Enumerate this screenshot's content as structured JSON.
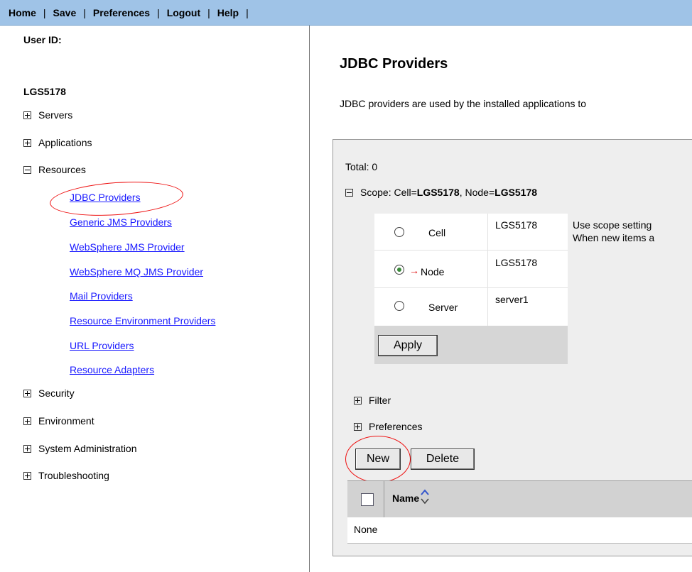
{
  "topnav": {
    "items": [
      "Home",
      "Save",
      "Preferences",
      "Logout",
      "Help"
    ],
    "separator": "|"
  },
  "leftnav": {
    "userid_label": "User ID:",
    "userid_value": "LGS5178",
    "tree": [
      {
        "label": "Servers",
        "state": "collapsed"
      },
      {
        "label": "Applications",
        "state": "collapsed"
      },
      {
        "label": "Resources",
        "state": "expanded"
      },
      {
        "label": "Security",
        "state": "collapsed"
      },
      {
        "label": "Environment",
        "state": "collapsed"
      },
      {
        "label": "System Administration",
        "state": "collapsed"
      },
      {
        "label": "Troubleshooting",
        "state": "collapsed"
      }
    ],
    "resources_children": [
      "JDBC Providers",
      "Generic JMS Providers",
      "WebSphere JMS Provider",
      "WebSphere MQ JMS Provider",
      "Mail Providers",
      "Resource Environment Providers",
      "URL Providers",
      "Resource Adapters"
    ]
  },
  "main": {
    "title": "JDBC Providers",
    "description": "JDBC providers are used by the installed applications to",
    "total": "Total: 0",
    "scope": {
      "prefix": "Scope: Cell=",
      "cell": "LGS5178",
      "mid": ", Node=",
      "node": "LGS5178"
    },
    "scope_rows": [
      {
        "level": "Cell",
        "value": "LGS5178",
        "selected": false
      },
      {
        "level": "Node",
        "value": "LGS5178",
        "selected": true
      },
      {
        "level": "Server",
        "value": "server1",
        "selected": false
      }
    ],
    "scope_help_1": "Use scope setting",
    "scope_help_2": "When new items a",
    "apply_label": "Apply",
    "filter_label": "Filter",
    "preferences_label": "Preferences",
    "new_label": "New",
    "delete_label": "Delete",
    "table": {
      "column_name": "Name",
      "empty": "None"
    }
  },
  "colors": {
    "topbar": "#9fc3e7",
    "link": "#1a1aff",
    "annotation": "#e11111"
  }
}
